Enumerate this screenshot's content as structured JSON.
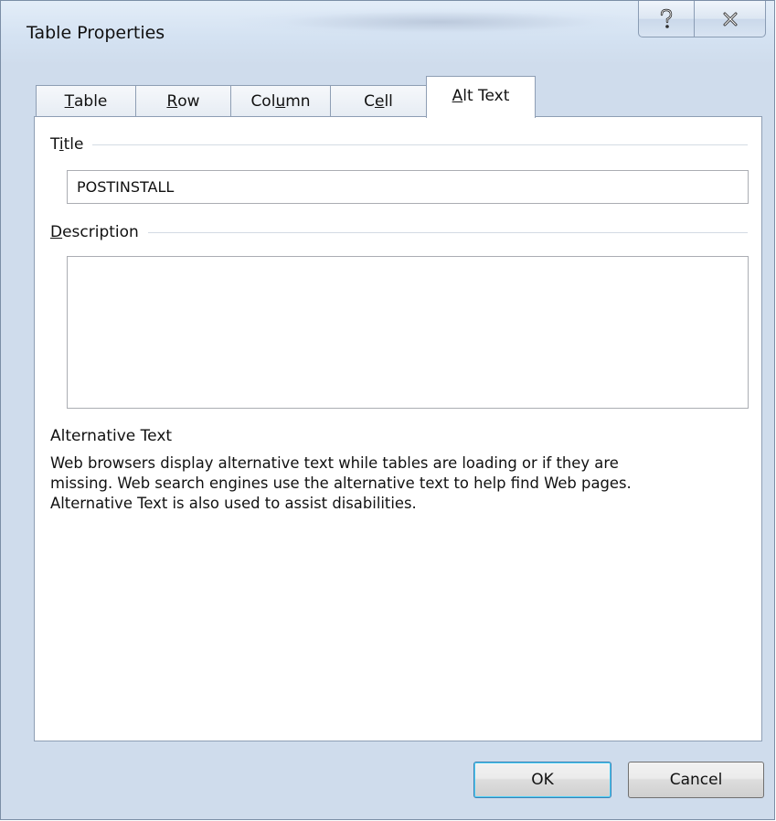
{
  "window": {
    "title": "Table Properties",
    "help_glyph": "?",
    "close_glyph": "✕"
  },
  "tabs": [
    {
      "pre": "",
      "key": "T",
      "post": "able",
      "active": false
    },
    {
      "pre": "",
      "key": "R",
      "post": "ow",
      "active": false
    },
    {
      "pre": "Col",
      "key": "u",
      "post": "mn",
      "active": false
    },
    {
      "pre": "C",
      "key": "e",
      "post": "ll",
      "active": false
    },
    {
      "pre": "",
      "key": "A",
      "post": "lt Text",
      "active": true
    }
  ],
  "alt_text": {
    "title_label": {
      "pre": "T",
      "key": "i",
      "post": "tle"
    },
    "title_value": "POSTINSTALL",
    "description_label": {
      "pre": "",
      "key": "D",
      "post": "escription"
    },
    "description_value": "",
    "info_heading": "Alternative Text",
    "info_body": "Web browsers display alternative text while tables are loading or if they are\nmissing.  Web search engines use the alternative text to help find Web pages.\nAlternative Text is also used to assist disabilities."
  },
  "buttons": {
    "ok": "OK",
    "cancel": "Cancel"
  },
  "icons": {
    "help": "help-icon",
    "close": "close-icon"
  },
  "colors": {
    "window_frame": "#cfdcec",
    "ok_focus_border": "#3c7fb1"
  }
}
